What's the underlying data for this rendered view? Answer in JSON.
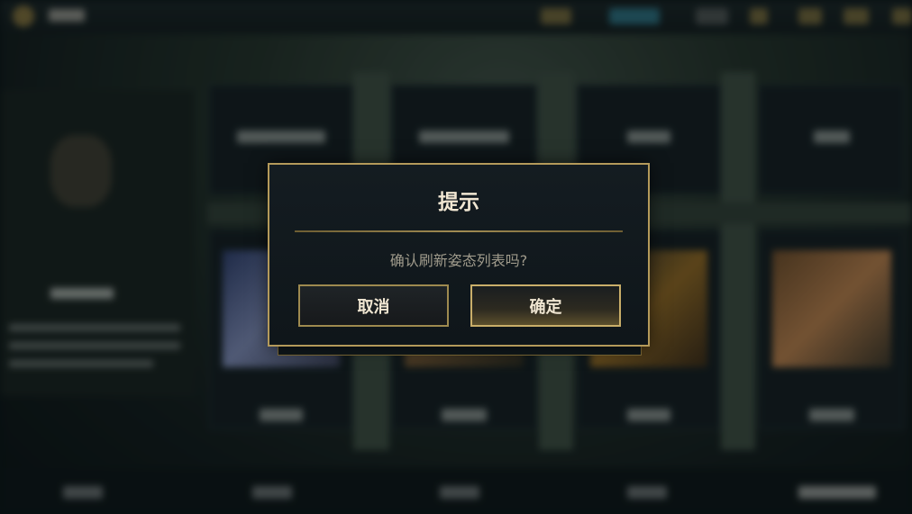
{
  "dialog": {
    "title": "提示",
    "message": "确认刷新姿态列表吗?",
    "cancel_label": "取消",
    "confirm_label": "确定"
  },
  "colors": {
    "accent_gold": "#c9ae69",
    "dialog_bg": "#141c21",
    "title_text": "#f0e6d2",
    "message_text": "#a09b8c"
  }
}
